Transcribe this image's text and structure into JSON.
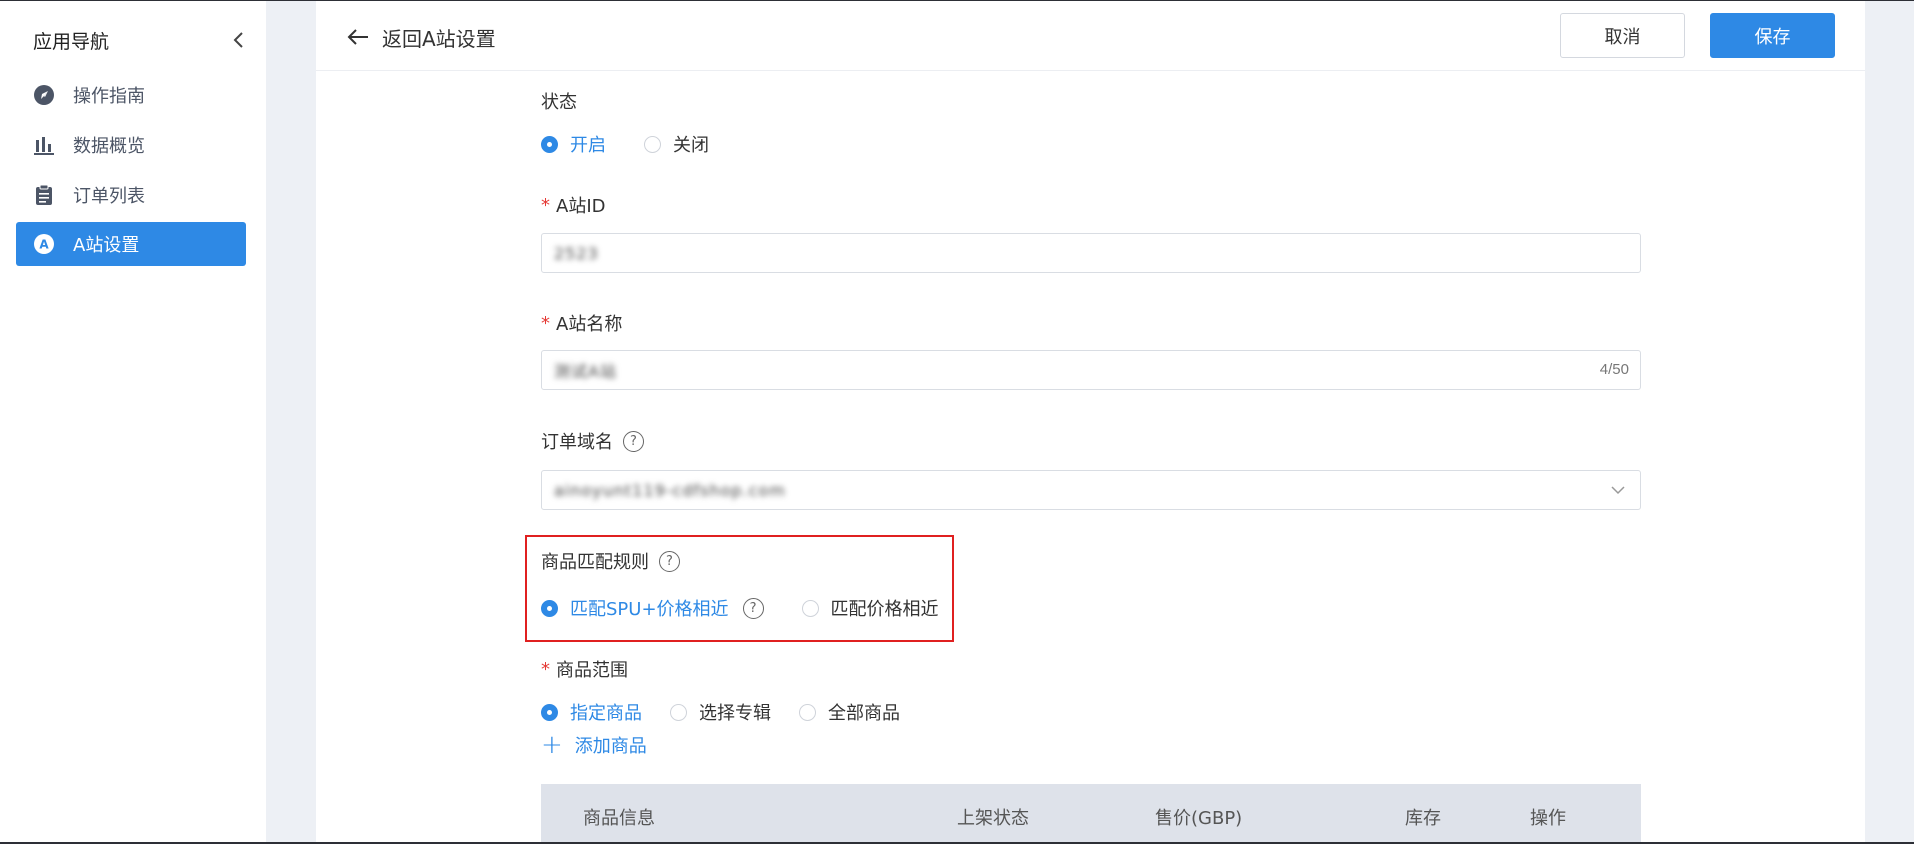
{
  "sidebar": {
    "title": "应用导航",
    "items": [
      {
        "label": "操作指南",
        "icon": "navigation-icon"
      },
      {
        "label": "数据概览",
        "icon": "bar-chart-icon"
      },
      {
        "label": "订单列表",
        "icon": "clipboard-icon"
      },
      {
        "label": "A站设置",
        "icon": "letter-a-icon",
        "active": true
      }
    ]
  },
  "header": {
    "back_label": "返回A站设置",
    "cancel_label": "取消",
    "save_label": "保存"
  },
  "form": {
    "status": {
      "label": "状态",
      "options": [
        "开启",
        "关闭"
      ],
      "selected": "开启"
    },
    "site_id": {
      "label": "A站ID",
      "value": "2523"
    },
    "site_name": {
      "label": "A站名称",
      "value": "测试A站",
      "counter": "4/50"
    },
    "order_domain": {
      "label": "订单域名",
      "value": "ainoyunt119-cdfshop.com"
    },
    "match_rule": {
      "label": "商品匹配规则",
      "options": [
        "匹配SPU+价格相近",
        "匹配价格相近"
      ],
      "selected": "匹配SPU+价格相近"
    },
    "product_scope": {
      "label": "商品范围",
      "options": [
        "指定商品",
        "选择专辑",
        "全部商品"
      ],
      "selected": "指定商品"
    },
    "add_product_label": "添加商品",
    "table_headers": [
      "商品信息",
      "上架状态",
      "售价(GBP)",
      "库存",
      "操作"
    ]
  },
  "colors": {
    "accent": "#2e89e5",
    "highlight": "#e02020",
    "required": "#e53935"
  }
}
